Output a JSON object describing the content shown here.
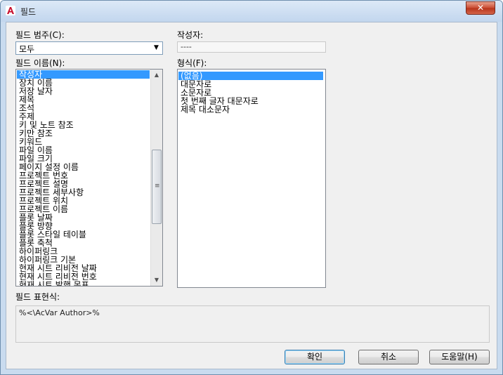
{
  "window": {
    "title": "필드"
  },
  "labels": {
    "category": "필드 범주(C):",
    "author": "작성자:",
    "names": "필드 이름(N):",
    "format": "형식(F):",
    "expression": "필드 표현식:"
  },
  "category": {
    "selected": "모두"
  },
  "author_value": "----",
  "field_names": [
    "작성자",
    "장치 이름",
    "저장 날자",
    "제목",
    "조석",
    "주제",
    "키 및 노트 참조",
    "키만 참조",
    "키워드",
    "파일 이름",
    "파일 크기",
    "페이지 설정 이름",
    "프로젝트 번호",
    "프로젝트 설명",
    "프로젝트 세부사항",
    "프로젝트 위치",
    "프로젝트 이름",
    "플롯 날짜",
    "플롯 방향",
    "플롯 스타일 테이블",
    "플롯 축척",
    "하이퍼링크",
    "하이퍼링크 기본",
    "현재 시트 리비전 날짜",
    "현재 시트 리비전 번호",
    "현재 시트 발행 목표"
  ],
  "formats": [
    "(없음)",
    "대문자로",
    "소문자로",
    "첫 번째 글자 대문자로",
    "제목 대소문자"
  ],
  "expression": "%<\\AcVar Author>%",
  "buttons": {
    "ok": "확인",
    "cancel": "취소",
    "help": "도움말(H)"
  }
}
